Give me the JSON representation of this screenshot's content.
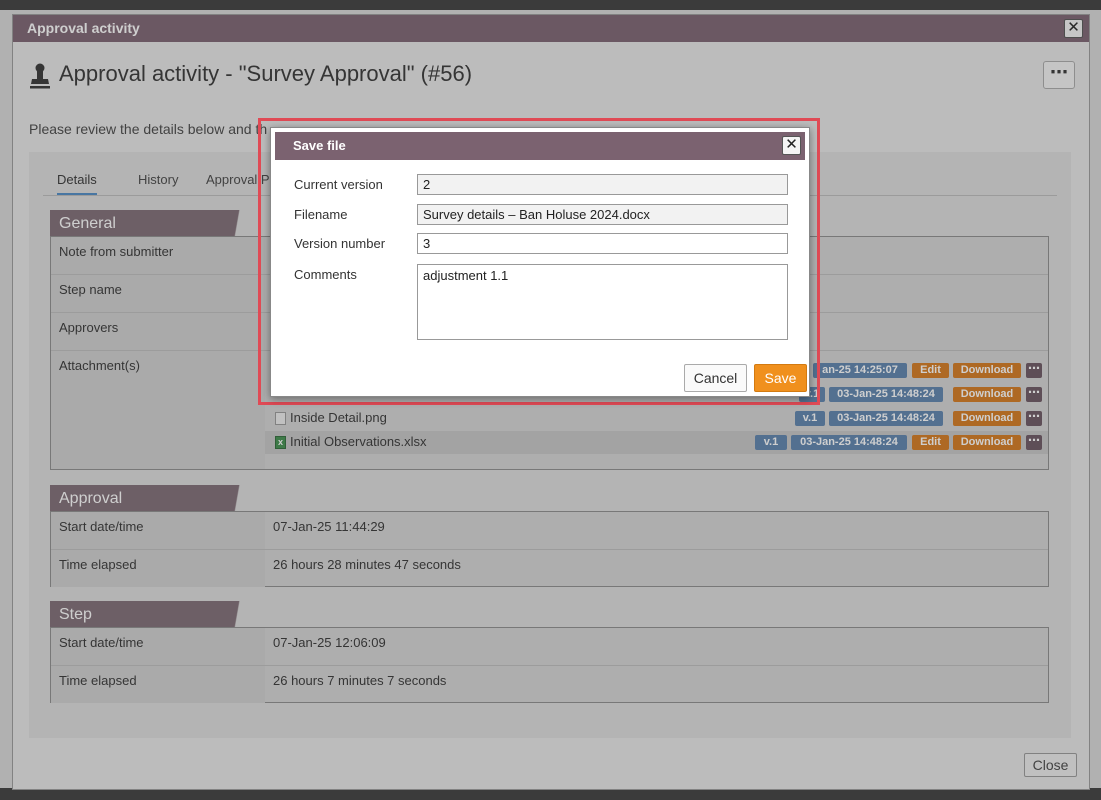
{
  "window": {
    "title": "Approval activity",
    "close_glyph": "✕",
    "heading": "Approval activity - \"Survey Approval\" (#56)",
    "more_glyph": "⋯",
    "intro": "Please review the details below and th",
    "close_label": "Close"
  },
  "tabs": [
    {
      "label": "Details",
      "active": true
    },
    {
      "label": "History",
      "active": false
    },
    {
      "label": "Approval Prog",
      "active": false
    }
  ],
  "general": {
    "header": "General",
    "rows": [
      {
        "label": "Note from submitter",
        "value": ""
      },
      {
        "label": "Step name",
        "value": ""
      },
      {
        "label": "Approvers",
        "value": ""
      },
      {
        "label": "Attachment(s)"
      }
    ],
    "attachments": [
      {
        "name": "",
        "version": "",
        "date": "an-25 14:25:07",
        "edit": "Edit",
        "download": "Download"
      },
      {
        "name": "",
        "version": "v.1",
        "date": "03-Jan-25 14:48:24",
        "download": "Download"
      },
      {
        "name": "Inside Detail.png",
        "version": "v.1",
        "date": "03-Jan-25 14:48:24",
        "download": "Download"
      },
      {
        "name": "Initial Observations.xlsx",
        "version": "v.1",
        "date": "03-Jan-25 14:48:24",
        "edit": "Edit",
        "download": "Download"
      }
    ],
    "dots_glyph": "⋯"
  },
  "approval": {
    "header": "Approval",
    "rows": [
      {
        "label": "Start date/time",
        "value": "07-Jan-25 11:44:29"
      },
      {
        "label": "Time elapsed",
        "value": "26 hours 28 minutes 47 seconds"
      }
    ]
  },
  "step": {
    "header": "Step",
    "rows": [
      {
        "label": "Start date/time",
        "value": "07-Jan-25 12:06:09"
      },
      {
        "label": "Time elapsed",
        "value": "26 hours 7 minutes 7 seconds"
      }
    ]
  },
  "modal": {
    "title": "Save file",
    "close_glyph": "✕",
    "fields": {
      "current_version": {
        "label": "Current version",
        "value": "2"
      },
      "filename": {
        "label": "Filename",
        "value": "Survey details – Ban Holuse 2024.docx"
      },
      "version_number": {
        "label": "Version number",
        "value": "3"
      },
      "comments": {
        "label": "Comments",
        "value": "adjustment 1.1"
      }
    },
    "cancel_label": "Cancel",
    "save_label": "Save"
  },
  "colors": {
    "titlebar": "#7b6270",
    "save": "#f0901d",
    "highlight_outline": "#e04a55"
  }
}
